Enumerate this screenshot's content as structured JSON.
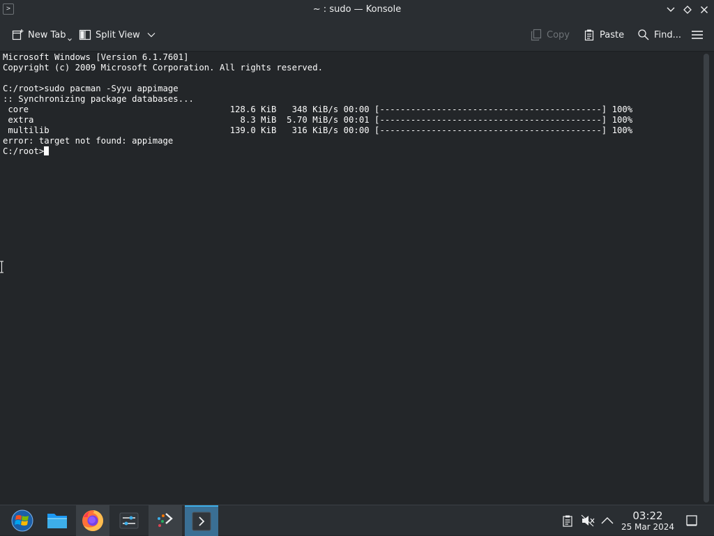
{
  "window": {
    "title": "~ : sudo — Konsole",
    "app_icon": "terminal-prompt-icon",
    "controls": [
      "minimize-icon",
      "maximize-icon",
      "close-icon"
    ]
  },
  "toolbar": {
    "new_tab_label": "New Tab",
    "split_view_label": "Split View",
    "copy_label": "Copy",
    "paste_label": "Paste",
    "find_label": "Find..."
  },
  "terminal": {
    "lines": [
      "Microsoft Windows [Version 6.1.7601]",
      "Copyright (c) 2009 Microsoft Corporation. All rights reserved.",
      "",
      "C:/root>sudo pacman -Syyu appimage",
      ":: Synchronizing package databases...",
      " core                                       128.6 KiB   348 KiB/s 00:00 [-------------------------------------------] 100%",
      " extra                                        8.3 MiB  5.70 MiB/s 00:01 [-------------------------------------------] 100%",
      " multilib                                   139.0 KiB   316 KiB/s 00:00 [-------------------------------------------] 100%",
      "error: target not found: appimage"
    ],
    "prompt": "C:/root>"
  },
  "taskbar": {
    "items": [
      "start-menu-icon",
      "file-manager-icon",
      "firefox-icon",
      "system-settings-icon",
      "discover-icon",
      "konsole-icon"
    ],
    "tray": [
      "clipboard-icon",
      "volume-muted-icon",
      "expand-tray-icon",
      "show-desktop-icon"
    ],
    "clock": {
      "time": "03:22",
      "date": "25 Mar 2024"
    }
  },
  "colors": {
    "terminal_bg": "#232629",
    "chrome_bg": "#2a2e32",
    "accent": "#3daee9",
    "text": "#fcfcfc"
  }
}
